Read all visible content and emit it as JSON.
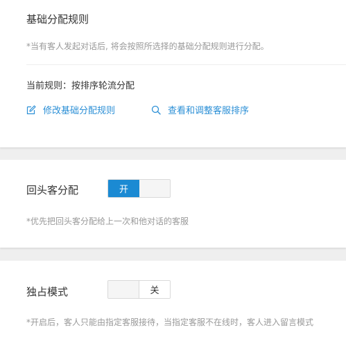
{
  "basic_rule": {
    "title": "基础分配规则",
    "description": "*当有客人发起对话后, 将会按照所选择的基础分配规则进行分配。",
    "current_rule": "当前规则：按排序轮流分配",
    "edit_link": "修改基础分配规则",
    "view_link": "查看和调整客服排序"
  },
  "returning_customer": {
    "label": "回头客分配",
    "toggle_state": "on",
    "toggle_on_text": "开",
    "description": "*优先把回头客分配给上一次和他对话的客服"
  },
  "exclusive_mode": {
    "label": "独占模式",
    "toggle_state": "off",
    "toggle_off_text": "关",
    "description": "*开启后，客人只能由指定客服接待，当指定客服不在线时，客人进入留言模式"
  },
  "colors": {
    "accent": "#1b8ad3",
    "link": "#2b8fd6",
    "muted_text": "#999999",
    "page_background": "#efefef"
  }
}
